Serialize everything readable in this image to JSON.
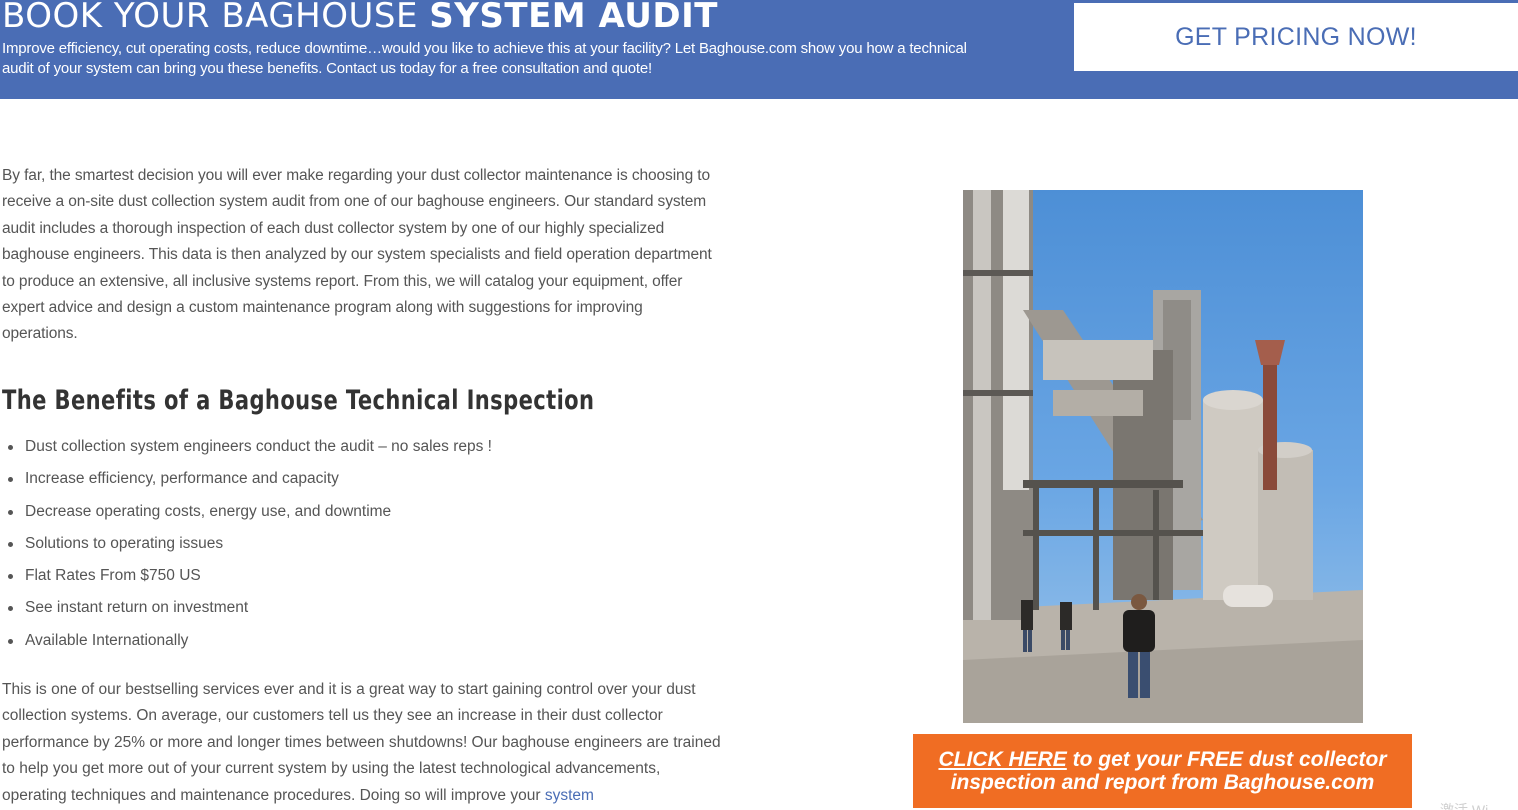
{
  "banner": {
    "title_light": "BOOK YOUR BAGHOUSE",
    "title_bold": "SYSTEM AUDIT",
    "text": "Improve efficiency, cut operating costs, reduce downtime…would you like to achieve this at your facility? Let Baghouse.com show you how a technical audit of your system can bring you these benefits. Contact us today for a free consultation and quote!",
    "pricing_button": "GET PRICING NOW!"
  },
  "intro": "By far, the smartest decision you will ever make regarding your dust collector maintenance is choosing to receive a on-site dust collection system audit from one of our baghouse engineers. Our standard system audit  includes a thorough  inspection of each dust collector system by one of our highly specialized baghouse engineers. This data is then analyzed by our system specialists and field operation department to produce an extensive, all inclusive systems report.  From this, we will catalog your equipment, offer expert advice and design a custom maintenance program along with suggestions for improving operations.",
  "benefits": {
    "heading": "The Benefits of a Baghouse Technical Inspection",
    "items": [
      "Dust collection system engineers conduct the audit – no sales reps !",
      "Increase efficiency, performance and capacity",
      "Decrease operating costs, energy use, and downtime",
      "Solutions to operating issues",
      "Flat Rates From $750 US",
      "See instant return on investment",
      "Available Internationally"
    ]
  },
  "outro": {
    "text": "This is one of our bestselling services ever and it is a great way to start gaining control over your dust collection systems. On average, our customers tell us they see an increase in their dust collector performance by 25% or more and longer times between shutdowns! Our baghouse engineers are trained to help you get more out of your current system by using the latest technological advancements, operating techniques and maintenance procedures. Doing so will improve your ",
    "link": "system"
  },
  "cta": {
    "link_text": "CLICK HERE",
    "line1_rest": " to get your FREE dust collector",
    "line2": "inspection and report from Baghouse.com"
  },
  "watermark": "激活 Wi",
  "colors": {
    "banner": "#4a6db5",
    "cta": "#f06d23",
    "body_text": "#555555",
    "heading": "#333333"
  }
}
